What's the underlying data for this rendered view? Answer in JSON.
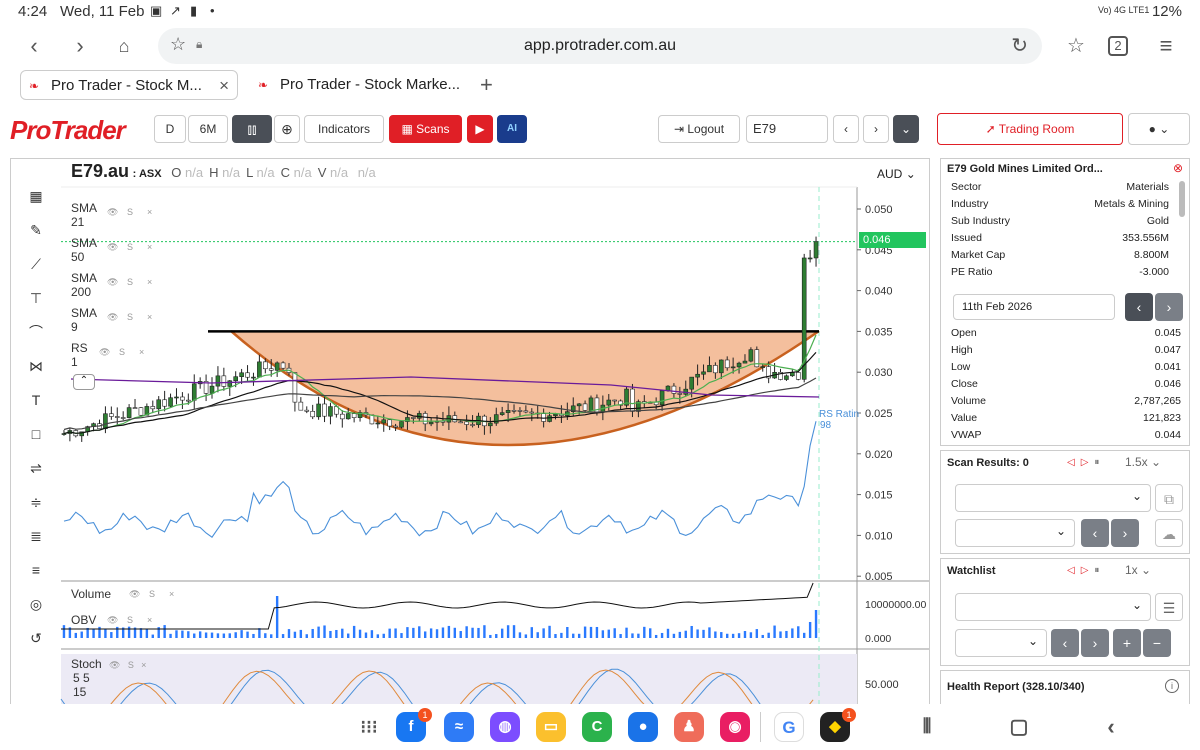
{
  "status_bar": {
    "time": "4:24",
    "date": "Wed, 11 Feb",
    "network": "Vo) 4G LTE1",
    "battery": "12%"
  },
  "browser": {
    "url": "app.protrader.com.au",
    "tab_count": "2",
    "tabs": [
      {
        "title": "Pro Trader - Stock M..."
      },
      {
        "title": "Pro Trader - Stock Marke..."
      }
    ]
  },
  "toolbar": {
    "logo": "ProTrader",
    "interval_d": "D",
    "range_6m": "6M",
    "indicators": "Indicators",
    "scans": "Scans",
    "ai": "AI",
    "logout": "Logout",
    "symbol": "E79",
    "trading_room": "Trading Room"
  },
  "chart_header": {
    "symbol": "E79.au",
    "exchange": ": ASX",
    "ohlcv": [
      {
        "k": "O",
        "v": "n/a"
      },
      {
        "k": "H",
        "v": "n/a"
      },
      {
        "k": "L",
        "v": "n/a"
      },
      {
        "k": "C",
        "v": "n/a"
      },
      {
        "k": "V",
        "v": "n/a"
      },
      {
        "k": "",
        "v": "n/a"
      }
    ],
    "currency": "AUD"
  },
  "legend": [
    {
      "name": "SMA",
      "param": "21"
    },
    {
      "name": "SMA",
      "param": "50"
    },
    {
      "name": "SMA",
      "param": "200"
    },
    {
      "name": "SMA",
      "param": "9"
    },
    {
      "name": "RS",
      "param": "1"
    }
  ],
  "legend_icons": {
    "s": "S",
    "x": "×"
  },
  "price_label": "0.046",
  "rs_label": {
    "line1": "RS Ratin",
    "line2": "98"
  },
  "vol_legend": [
    {
      "name": "Volume"
    },
    {
      "name": "OBV"
    }
  ],
  "stoch_legend": {
    "name": "Stoch",
    "p1": "5 5",
    "p2": "15"
  },
  "chart_data": {
    "type": "candlestick",
    "price_ticks": [
      "0.050",
      "0.045",
      "0.040",
      "0.035",
      "0.030",
      "0.025",
      "0.020",
      "0.015",
      "0.010",
      "0.005"
    ],
    "vol_ticks": [
      "10000000.00",
      "0.000"
    ],
    "stoch_ticks": [
      "50.000"
    ],
    "resistance_level": 0.035,
    "last_close": 0.046
  },
  "info": {
    "title": "E79 Gold Mines Limited Ord...",
    "fields": [
      {
        "k": "Sector",
        "v": "Materials"
      },
      {
        "k": "Industry",
        "v": "Metals & Mining"
      },
      {
        "k": "Sub Industry",
        "v": "Gold"
      },
      {
        "k": "Issued",
        "v": "353.556M"
      },
      {
        "k": "Market Cap",
        "v": "8.800M"
      },
      {
        "k": "PE Ratio",
        "v": "-3.000"
      }
    ],
    "date": "11th Feb 2026",
    "quote": [
      {
        "k": "Open",
        "v": "0.045"
      },
      {
        "k": "High",
        "v": "0.047"
      },
      {
        "k": "Low",
        "v": "0.041"
      },
      {
        "k": "Close",
        "v": "0.046"
      },
      {
        "k": "Volume",
        "v": "2,787,265"
      },
      {
        "k": "Value",
        "v": "121,823"
      },
      {
        "k": "VWAP",
        "v": "0.044"
      }
    ]
  },
  "scan": {
    "title": "Scan Results: 0",
    "speed": "1.5x"
  },
  "watchlist": {
    "title": "Watchlist",
    "speed": "1x"
  },
  "health": {
    "title": "Health Report (328.10/340)"
  },
  "colors": {
    "brand": "#e01f26",
    "candle": "#2e7d32",
    "ma_green": "#4caf50",
    "ma_black": "#111",
    "ma_purple": "#6a1b9a",
    "rs_blue": "#4a90d9",
    "cup": "#f2b48c"
  },
  "badges": {
    "facebook": "1",
    "feedly": "1"
  }
}
